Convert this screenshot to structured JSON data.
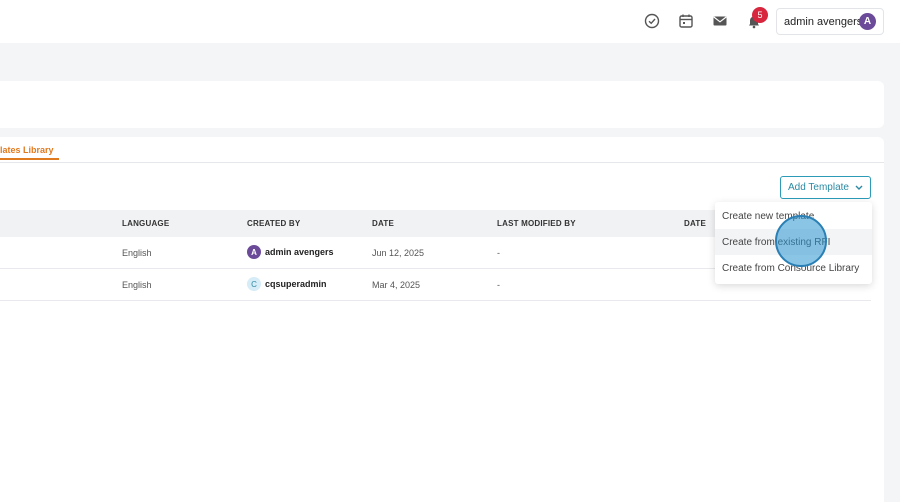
{
  "topbar": {
    "icons": [
      "check-circle-icon",
      "calendar-icon",
      "mail-icon",
      "bell-icon"
    ],
    "notification_count": "5",
    "user_name": "admin avengers",
    "user_avatar_letter": "A"
  },
  "tabs": {
    "active_label": "lates Library"
  },
  "actions": {
    "add_template_label": "Add Template"
  },
  "table": {
    "headers": [
      "LANGUAGE",
      "CREATED BY",
      "DATE",
      "LAST MODIFIED BY",
      "DATE"
    ],
    "rows": [
      {
        "language": "English",
        "created_by": "admin avengers",
        "avatar_letter": "A",
        "date": "Jun 12, 2025",
        "last_modified_by": "-"
      },
      {
        "language": "English",
        "created_by": "cqsuperadmin",
        "avatar_letter": "C",
        "date": "Mar 4, 2025",
        "last_modified_by": "-"
      }
    ]
  },
  "dropdown": {
    "items": [
      "Create new template",
      "Create from existing RFI",
      "Create from Consource Library"
    ]
  },
  "colors": {
    "accent_orange": "#e07a1f",
    "accent_teal": "#2b9bb8",
    "badge_red": "#d7263d"
  }
}
